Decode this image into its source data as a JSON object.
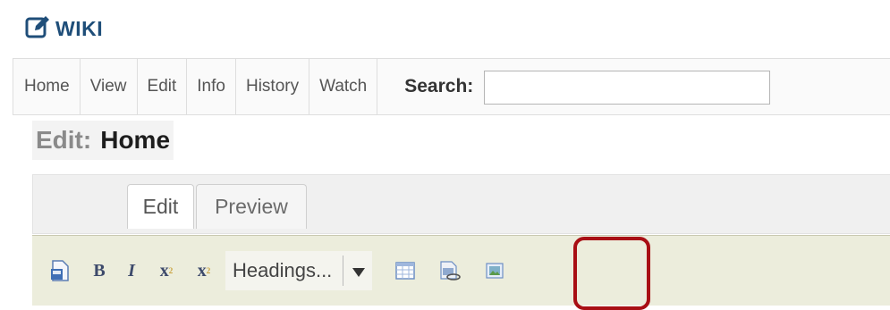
{
  "header": {
    "title": "WIKI",
    "icon": "edit-icon"
  },
  "nav": {
    "items": [
      "Home",
      "View",
      "Edit",
      "Info",
      "History",
      "Watch"
    ],
    "search_label": "Search:",
    "search_value": ""
  },
  "page": {
    "title_prefix": "Edit:",
    "title": "Home"
  },
  "tabs": [
    "Edit",
    "Preview"
  ],
  "toolbar": {
    "buttons": [
      "save-icon",
      "bold",
      "italic",
      "superscript",
      "subscript",
      "headings",
      "table-icon",
      "image-link-icon",
      "image-icon"
    ],
    "bold_label": "B",
    "italic_label": "I",
    "superscript_label": "x",
    "subscript_label": "x",
    "headings_label": "Headings..."
  },
  "colors": {
    "brand": "#1f4e79",
    "highlight": "#a80f14",
    "toolbar_bg": "#eceddc"
  }
}
